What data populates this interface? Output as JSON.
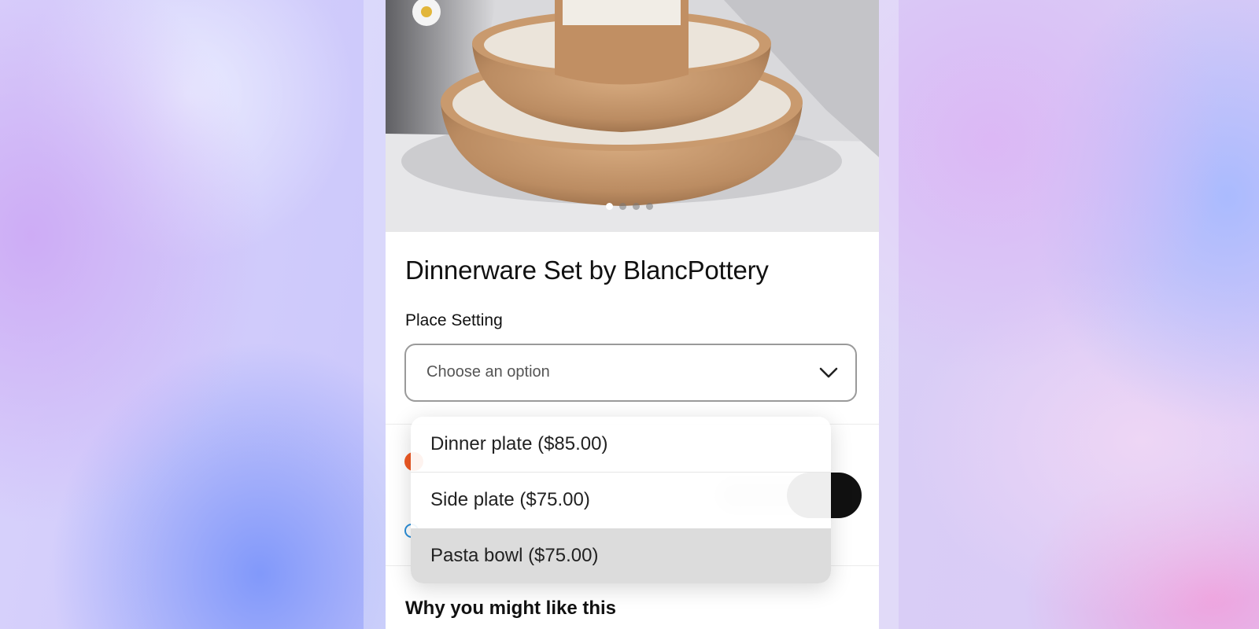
{
  "product": {
    "title": "Dinnerware Set by BlancPottery",
    "image_alt": "Speckled ceramic bowls stacked on a white shelf",
    "carousel": {
      "count": 4,
      "active": 1
    }
  },
  "place_setting": {
    "label": "Place Setting",
    "placeholder": "Choose an option",
    "options": [
      {
        "label": "Dinner plate ($85.00)",
        "selected": false
      },
      {
        "label": "Side plate ($75.00)",
        "selected": false
      },
      {
        "label": "Pasta bowl ($75.00)",
        "selected": true
      }
    ]
  },
  "sections": {
    "why_like": "Why you might like this"
  },
  "colors": {
    "accent_badge": "#f05a24",
    "link_icon": "#2a8ed8",
    "button": "#111111",
    "selected_option": "#dcdcdc"
  },
  "icons": {
    "select_chevron": "chevron-down-icon"
  }
}
